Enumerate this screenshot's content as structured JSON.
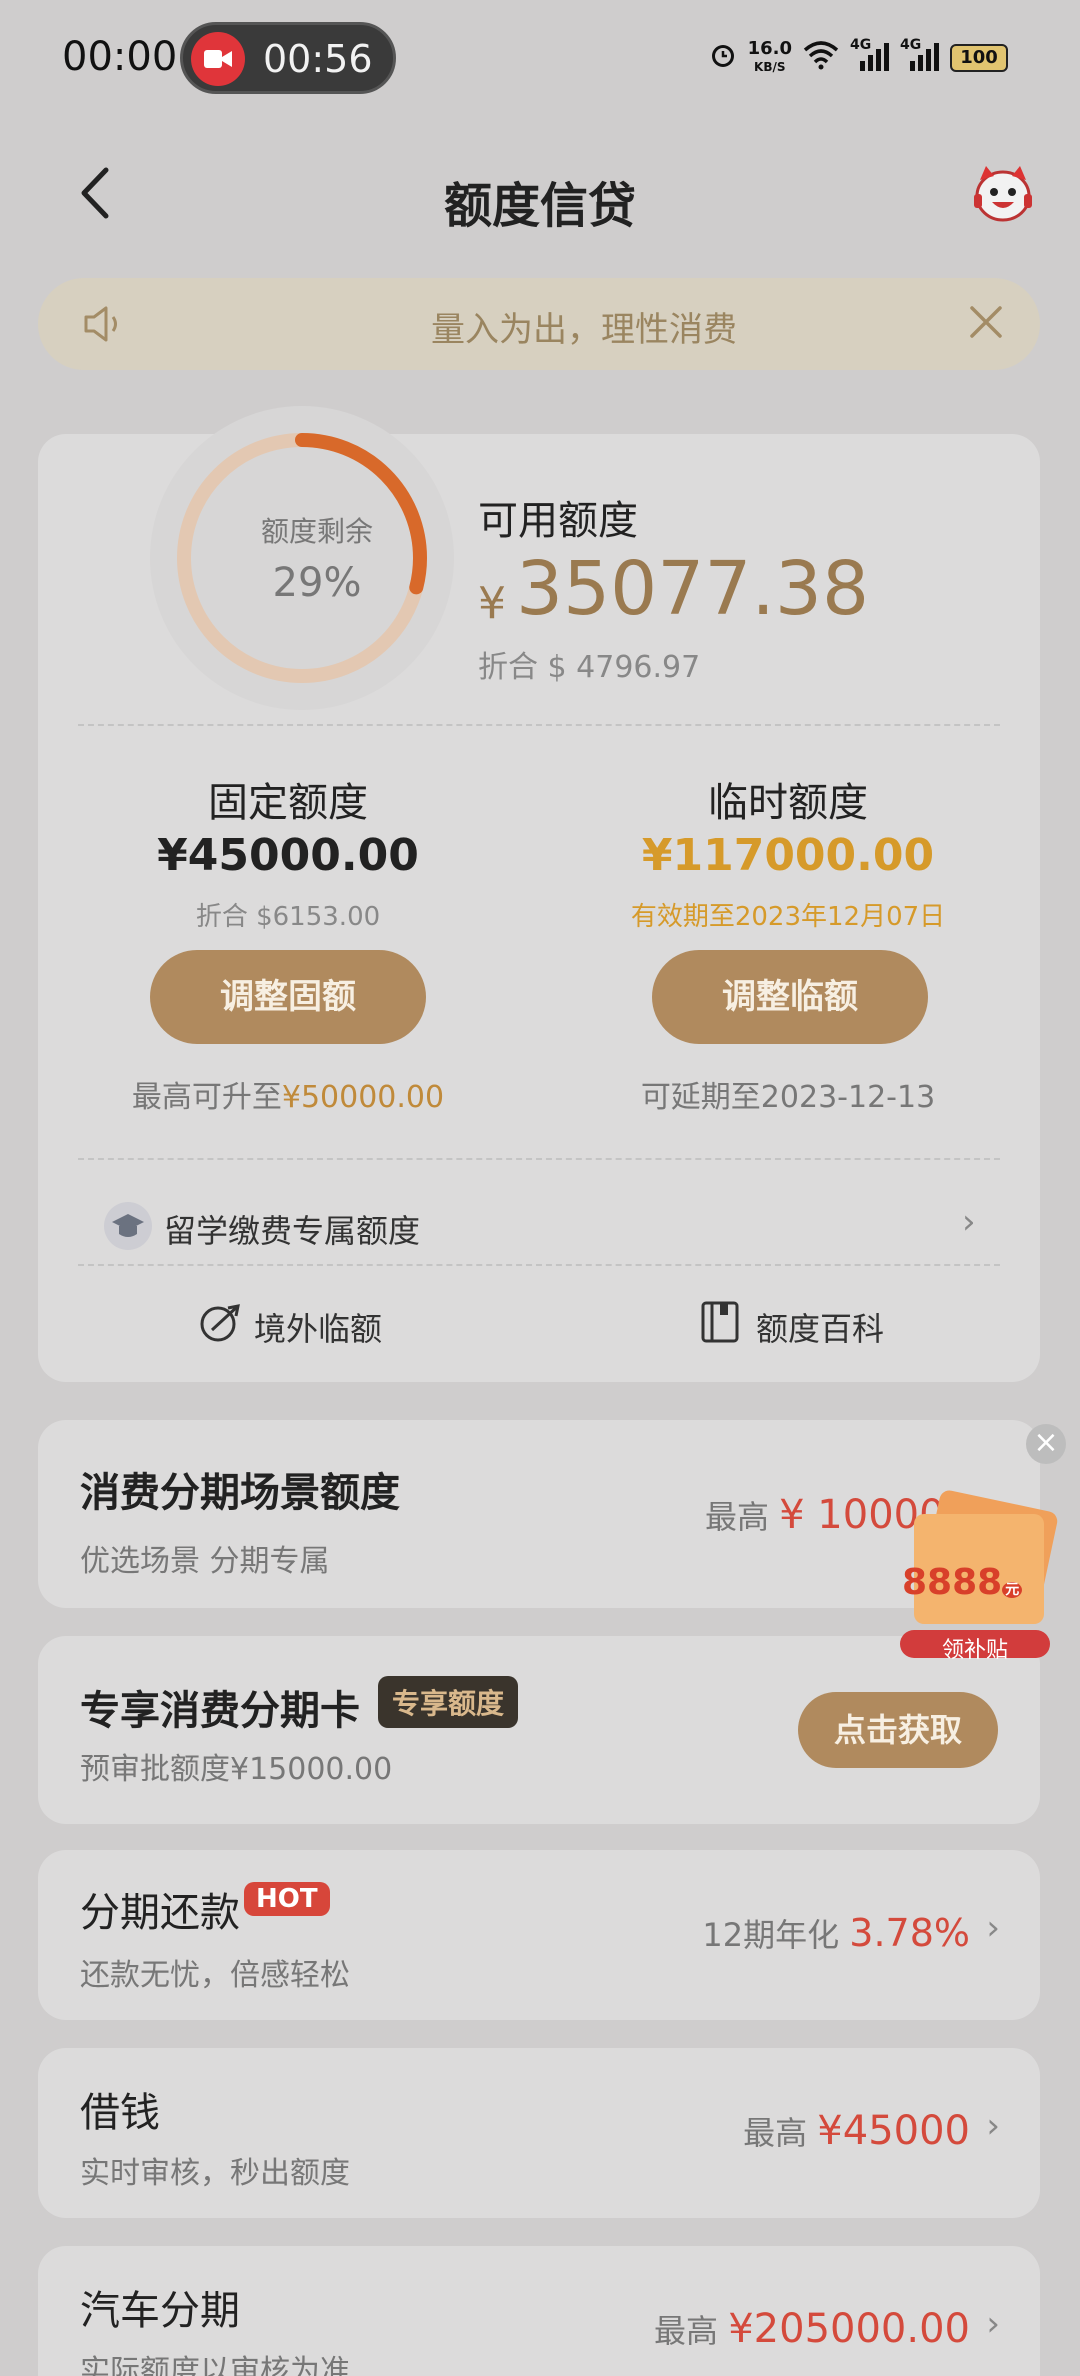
{
  "status_bar": {
    "time": "00:00",
    "record_time": "00:56",
    "net_speed_value": "16.0",
    "net_speed_unit": "KB/S",
    "net1": "4G",
    "net2": "4G",
    "battery": "100"
  },
  "header": {
    "title": "额度信贷"
  },
  "notice": {
    "text": "量入为出，理性消费"
  },
  "credit": {
    "ring_label": "额度剩余",
    "ring_percent": "29%",
    "ring_fraction": 0.29,
    "available_label": "可用额度",
    "currency": "¥",
    "available_amount": "35077.38",
    "available_usd": "折合 $ 4796.97",
    "fixed": {
      "title": "固定额度",
      "amount": "¥45000.00",
      "usd": "折合 $6153.00",
      "button": "调整固额",
      "foot_prefix": "最高可升至",
      "foot_value": "¥50000.00"
    },
    "temp": {
      "title": "临时额度",
      "amount": "¥117000.00",
      "validity": "有效期至2023年12月07日",
      "button": "调整临额",
      "foot": "可延期至2023-12-13"
    },
    "study_abroad": "留学缴费专属额度",
    "overseas": "境外临额",
    "wiki": "额度百科"
  },
  "installment_scene": {
    "title": "消费分期场景额度",
    "sub": "优选场景 分期专属",
    "right_prefix": "最高",
    "right_value": "¥ 100000"
  },
  "exclusive_card": {
    "title": "专享消费分期卡",
    "tag": "专享额度",
    "sub": "预审批额度¥15000.00",
    "button": "点击获取"
  },
  "repay": {
    "title": "分期还款",
    "tag": "HOT",
    "sub": "还款无忧，倍感轻松",
    "right_prefix": "12期年化",
    "right_value": "3.78%"
  },
  "borrow": {
    "title": "借钱",
    "sub": "实时审核，秒出额度",
    "right_prefix": "最高",
    "right_value": "¥45000"
  },
  "car": {
    "title": "汽车分期",
    "sub": "实际额度以审核为准",
    "right_prefix": "最高",
    "right_value": "¥205000.00"
  },
  "coupon": {
    "value": "8888",
    "unit": "元",
    "label": "领补贴"
  },
  "colors": {
    "accent_gold": "#b08a5e",
    "ring_orange": "#d8692a",
    "temp_amount": "#d69a2a",
    "price_red": "#d44a3c"
  }
}
